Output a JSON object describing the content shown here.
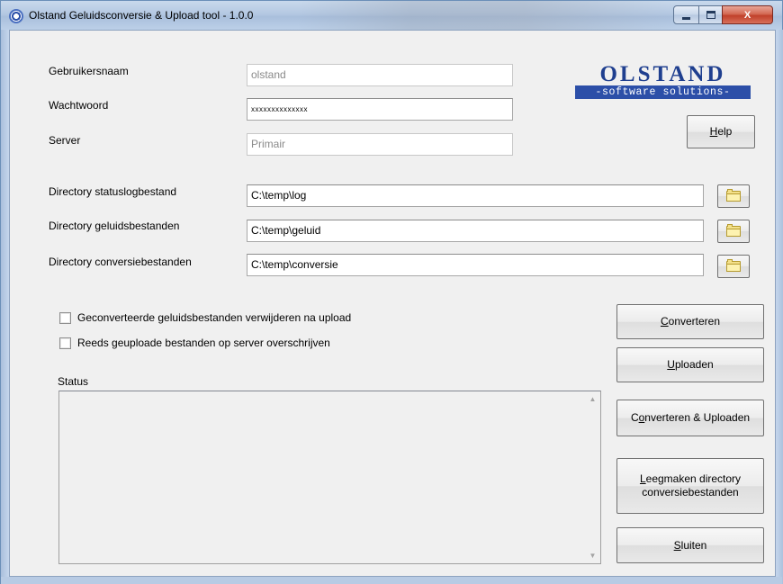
{
  "window": {
    "title": "Olstand Geluidsconversie & Upload tool - 1.0.0",
    "app_icon": "olstand-app-icon",
    "caption_buttons": [
      "minimize",
      "maximize",
      "close"
    ],
    "close_glyph": "X"
  },
  "credentials": {
    "username_label": "Gebruikersnaam",
    "username_value": "olstand",
    "password_label": "Wachtwoord",
    "password_value": "xxxxxxxxxxxxxx",
    "server_label": "Server",
    "server_value": "Primair"
  },
  "logo": {
    "name": "OLSTAND",
    "tagline": "-software solutions-",
    "color": "#1f3f8f"
  },
  "help_button": {
    "accel": "H",
    "rest": "elp"
  },
  "directories": [
    {
      "label": "Directory statuslogbestand",
      "value": "C:\\temp\\log",
      "icon": "folder-icon"
    },
    {
      "label": "Directory geluidsbestanden",
      "value": "C:\\temp\\geluid",
      "icon": "folder-icon"
    },
    {
      "label": "Directory conversiebestanden",
      "value": "C:\\temp\\conversie",
      "icon": "folder-icon"
    }
  ],
  "options": [
    {
      "label": "Geconverteerde geluidsbestanden verwijderen na upload",
      "checked": false
    },
    {
      "label": "Reeds geuploade bestanden op server overschrijven",
      "checked": false
    }
  ],
  "status": {
    "label": "Status",
    "text": ""
  },
  "actions": {
    "convert": {
      "accel": "C",
      "rest": "onverteren"
    },
    "upload": {
      "accel": "U",
      "rest": "ploaden"
    },
    "convert_upload": {
      "pre": "C",
      "accel": "o",
      "rest": "nverteren & Uploaden"
    },
    "clear_dir": {
      "accel": "L",
      "rest_line1": "eegmaken directory",
      "line2": "conversiebestanden"
    },
    "close": {
      "accel": "S",
      "rest": "luiten"
    }
  }
}
